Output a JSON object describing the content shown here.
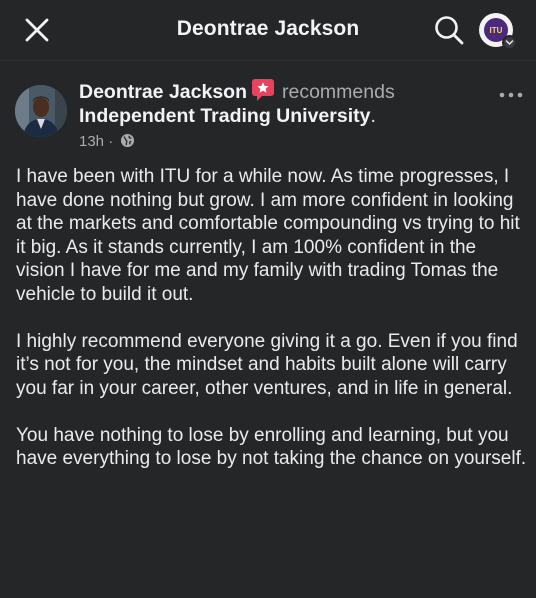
{
  "topbar": {
    "title": "Deontrae Jackson",
    "close_icon": "close-icon",
    "search_icon": "search-icon",
    "profile_logo_text": "ITU"
  },
  "post": {
    "author": "Deontrae Jackson",
    "action": "recommends",
    "page": "Independent Trading University",
    "page_suffix": ".",
    "time": "13h",
    "separator": "·",
    "audience_icon": "globe-icon",
    "recommend_icon": "recommend-star-icon",
    "more_icon": "more-dots-icon",
    "colors": {
      "recommend": "#e9415e",
      "background": "#252628"
    },
    "paragraphs": [
      "I have been with ITU for a while now. As time progresses, I have done nothing but grow. I am more confident in looking at the markets and comfortable compounding vs trying to hit it big. As it stands currently, I am 100% confident in the vision I have for me and my family with trading Tomas the vehicle to build it out.",
      "I highly recommend everyone giving it a go. Even if you find it’s not for you, the mindset and habits built alone will carry you far in your career, other ventures, and in life in general.",
      "You have nothing to lose by enrolling and learning, but you have everything to lose by not taking the chance on yourself."
    ]
  }
}
